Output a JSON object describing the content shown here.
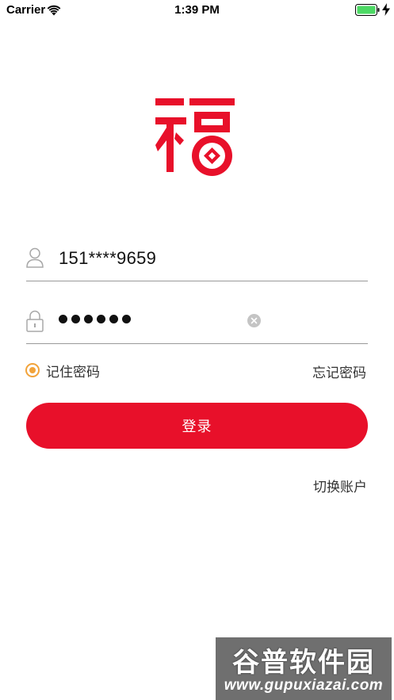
{
  "status_bar": {
    "carrier": "Carrier",
    "time": "1:39 PM",
    "wifi_icon": "wifi-icon",
    "battery_icon": "battery-full-icon",
    "charging_icon": "charging-bolt-icon",
    "battery_color": "#4cd964"
  },
  "logo": {
    "icon": "fu-logo-icon",
    "color": "#e8102a"
  },
  "login_form": {
    "phone": {
      "icon": "user-icon",
      "value": "151****9659"
    },
    "password": {
      "icon": "lock-icon",
      "dot_count": 6,
      "clear_icon": "clear-circle-icon"
    },
    "remember_password": {
      "label": "记住密码",
      "checked": true,
      "color": "#f2a33a"
    },
    "forgot_password": "忘记密码",
    "login_button": "登录",
    "switch_account": "切换账户",
    "accent_color": "#e8102a"
  },
  "watermark": {
    "title": "谷普软件园",
    "url": "www.gupuxiazai.com"
  }
}
